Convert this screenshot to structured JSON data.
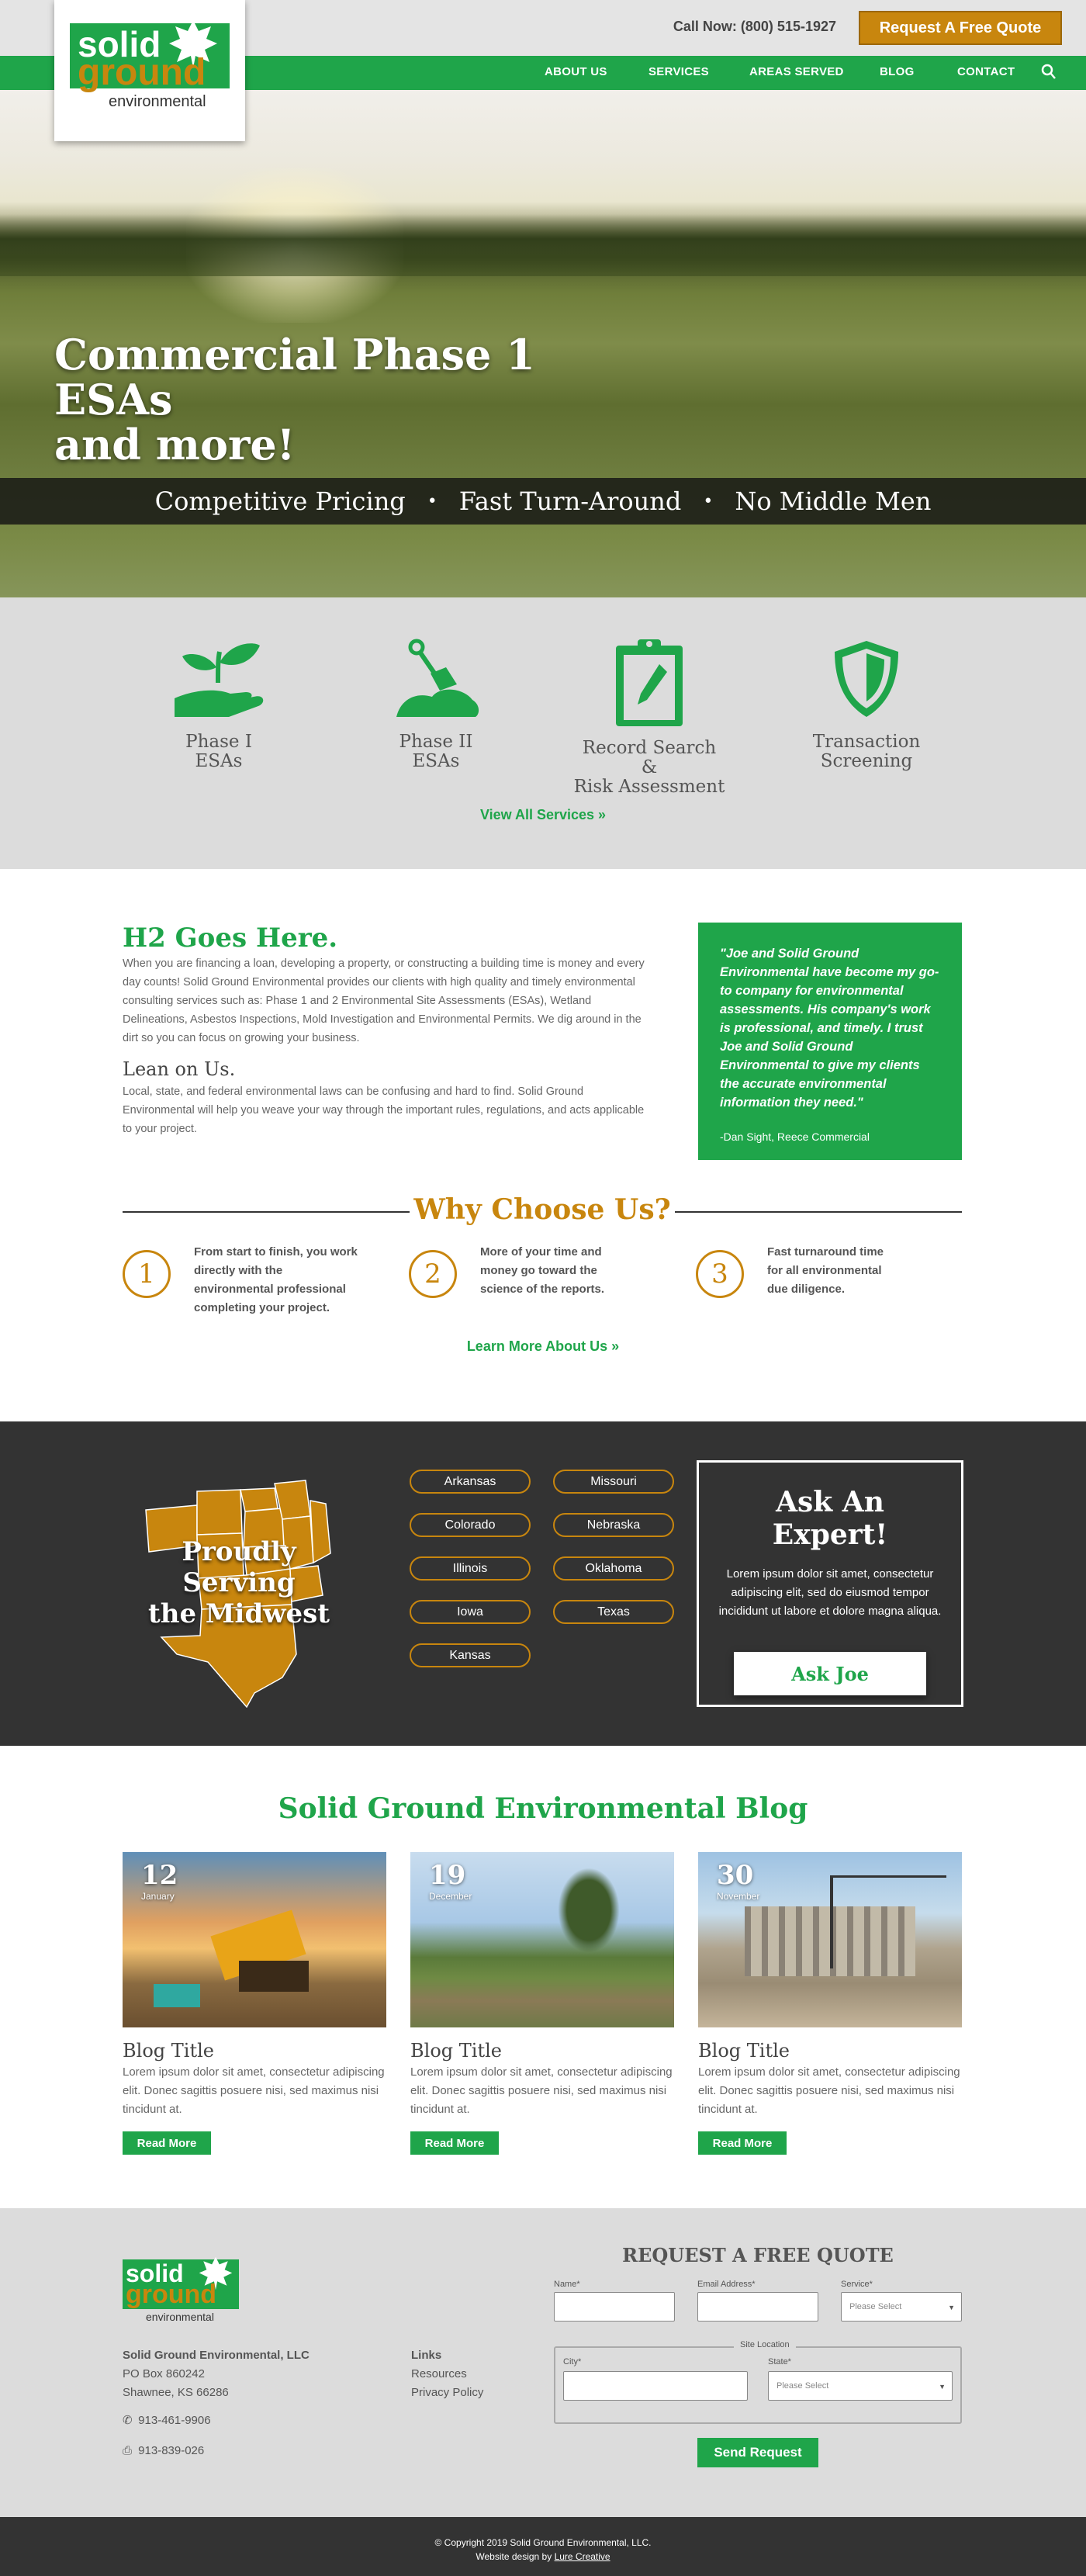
{
  "header": {
    "call_label": "Call Now: (800) 515-1927",
    "quote_button": "Request A Free Quote",
    "logo": {
      "word1": "solid",
      "word2": "ground",
      "word3": "environmental"
    },
    "nav": [
      "ABOUT US",
      "SERVICES",
      "AREAS SERVED",
      "BLOG",
      "CONTACT"
    ]
  },
  "hero": {
    "title_line1": "Commercial Phase 1 ESAs",
    "title_line2": "and more!",
    "band": [
      "Competitive Pricing",
      "Fast Turn-Around",
      "No Middle Men"
    ],
    "separator": "•"
  },
  "services": {
    "items": [
      {
        "line1": "Phase I",
        "line2": "ESAs",
        "icon": "plant-in-hand-icon"
      },
      {
        "line1": "Phase II",
        "line2": "ESAs",
        "icon": "shovel-soil-icon"
      },
      {
        "line1": "Record Search &",
        "line2": "Risk Assessment",
        "icon": "clipboard-pen-icon"
      },
      {
        "line1": "Transaction",
        "line2": "Screening",
        "icon": "shield-icon"
      }
    ],
    "view_all": "View All Services »"
  },
  "intro": {
    "h2": "H2 Goes Here.",
    "p1": "When you are financing a loan, developing a property, or constructing a building time is money and every day counts! Solid Ground Environmental provides our clients with high quality and timely environmental consulting services such as: Phase 1 and 2 Environmental Site Assessments (ESAs), Wetland Delineations, Asbestos Inspections, Mold Investigation and Environmental Permits. We dig around in the dirt so you can focus on growing your business.",
    "h3": "Lean on Us.",
    "p2": "Local, state, and federal environmental laws can be confusing and hard to find. Solid Ground Environmental will help you weave your way through the important rules, regulations, and acts applicable to your project.",
    "testimonial": "\"Joe and Solid Ground Environmental have become my go-to company for environmental assessments. His company's work is professional, and timely. I trust Joe and Solid Ground Environmental to give my clients the accurate environmental information they need.\"",
    "testimonial_by": "-Dan Sight, Reece Commercial"
  },
  "why": {
    "title": "Why Choose Us?",
    "items": [
      {
        "num": "1",
        "text": "From start to finish, you work directly with the environmental professional completing your project."
      },
      {
        "num": "2",
        "text": "More of your time and money go toward the science of the reports."
      },
      {
        "num": "3",
        "text": "Fast turnaround time for all environmental due diligence."
      }
    ],
    "learn_more": "Learn More About Us »"
  },
  "midwest": {
    "title_line1": "Proudly Serving",
    "title_line2": "the Midwest",
    "states_col1": [
      "Arkansas",
      "Colorado",
      "Illinois",
      "Iowa",
      "Kansas"
    ],
    "states_col2": [
      "Missouri",
      "Nebraska",
      "Oklahoma",
      "Texas"
    ],
    "map_color": "#c8860e"
  },
  "expert": {
    "title": "Ask An Expert!",
    "text": "Lorem ipsum dolor sit amet, consectetur adipiscing elit, sed do eiusmod tempor incididunt ut labore et dolore magna aliqua.",
    "button": "Ask Joe"
  },
  "blog": {
    "title": "Solid Ground Environmental Blog",
    "posts": [
      {
        "day": "12",
        "month": "January",
        "title": "Blog Title",
        "excerpt": "Lorem ipsum dolor sit amet, consectetur adipiscing elit. Donec sagittis posuere nisi, sed maximus nisi tincidunt at.",
        "button": "Read More"
      },
      {
        "day": "19",
        "month": "December",
        "title": "Blog Title",
        "excerpt": "Lorem ipsum dolor sit amet, consectetur adipiscing elit. Donec sagittis posuere nisi, sed maximus nisi tincidunt at.",
        "button": "Read More"
      },
      {
        "day": "30",
        "month": "November",
        "title": "Blog Title",
        "excerpt": "Lorem ipsum dolor sit amet, consectetur adipiscing elit. Donec sagittis posuere nisi, sed maximus nisi tincidunt at.",
        "button": "Read More"
      }
    ]
  },
  "footer": {
    "company": "Solid Ground Environmental, LLC",
    "address1": "PO Box 860242",
    "address2": "Shawnee, KS 66286",
    "phone": "913-461-9906",
    "fax": "913-839-026",
    "links_title": "Links",
    "links": [
      "Resources",
      "Privacy Policy"
    ],
    "form_title": "REQUEST A FREE QUOTE",
    "name_label": "Name*",
    "email_label": "Email Address*",
    "service_label": "Service*",
    "service_placeholder": "Please Select",
    "site_location": "Site Location",
    "city_label": "City*",
    "state_label": "State*",
    "state_placeholder": "Please Select",
    "send": "Send Request"
  },
  "bottom": {
    "copyright": "© Copyright 2019 Solid Ground Environmental, LLC.",
    "design_prefix": "Website design by",
    "design_link": "Lure Creative"
  },
  "colors": {
    "green": "#1fa54a",
    "gold": "#c8860e",
    "dark": "#333333",
    "gray": "#dcdcdc"
  }
}
